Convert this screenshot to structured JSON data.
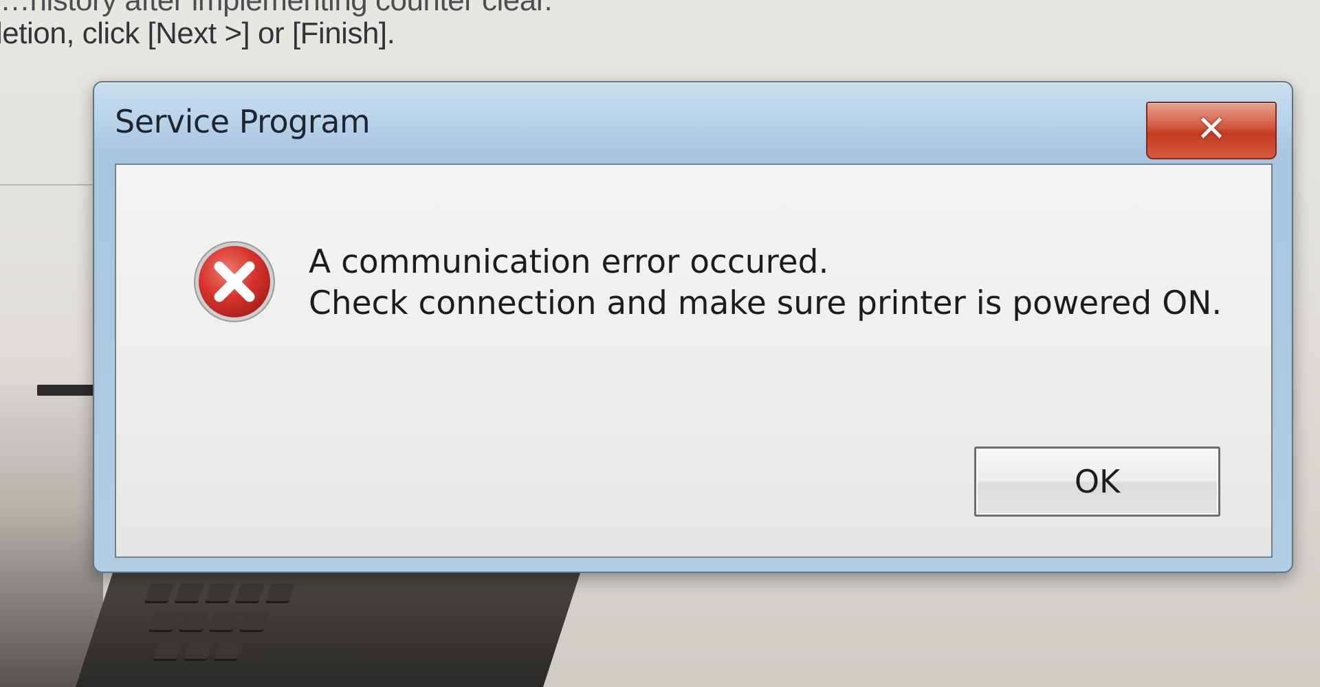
{
  "background_window": {
    "line_1": "…history after implementing counter clear.",
    "line_2": "letion, click [Next >] or [Finish]."
  },
  "dialog": {
    "title": "Service Program",
    "close_glyph": "✕",
    "icon": "error-icon",
    "message_line_1": "A communication error occured.",
    "message_line_2": "Check connection and make sure printer is powered ON.",
    "ok_label": "OK"
  },
  "colors": {
    "close_button": "#c94a30",
    "error_icon": "#d8332c",
    "title_bar": "#b6d1e8"
  }
}
